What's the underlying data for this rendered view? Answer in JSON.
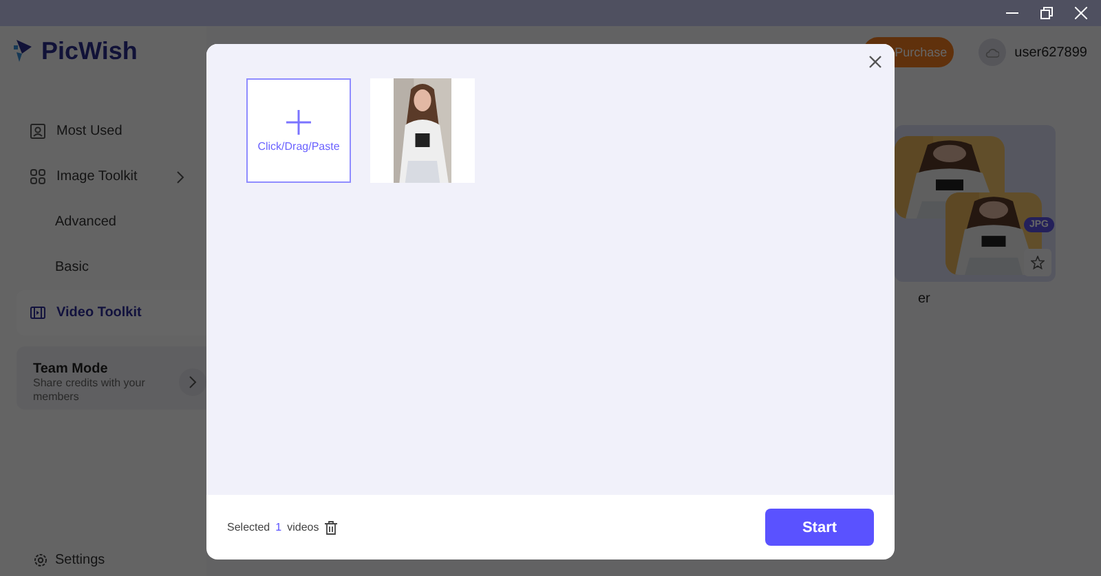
{
  "app": {
    "logo": "PicWish"
  },
  "header": {
    "purchase": "Purchase",
    "user": "user627899"
  },
  "sidebar": {
    "items": [
      {
        "label": "Most Used",
        "selected": false
      },
      {
        "label": "Image Toolkit",
        "selected": false,
        "children": [
          {
            "label": "Advanced",
            "selected": false
          },
          {
            "label": "Basic",
            "selected": false
          }
        ]
      },
      {
        "label": "Video Toolkit",
        "selected": true
      }
    ],
    "team_mode": {
      "title": "Team Mode",
      "description": "Share credits with your members"
    },
    "settings": "Settings"
  },
  "card": {
    "badge": "JPG",
    "caption": "er"
  },
  "modal": {
    "upload_label": "Click/Drag/Paste",
    "footer": {
      "prefix": "Selected",
      "count": "1",
      "suffix": "videos",
      "start": "Start"
    }
  }
}
